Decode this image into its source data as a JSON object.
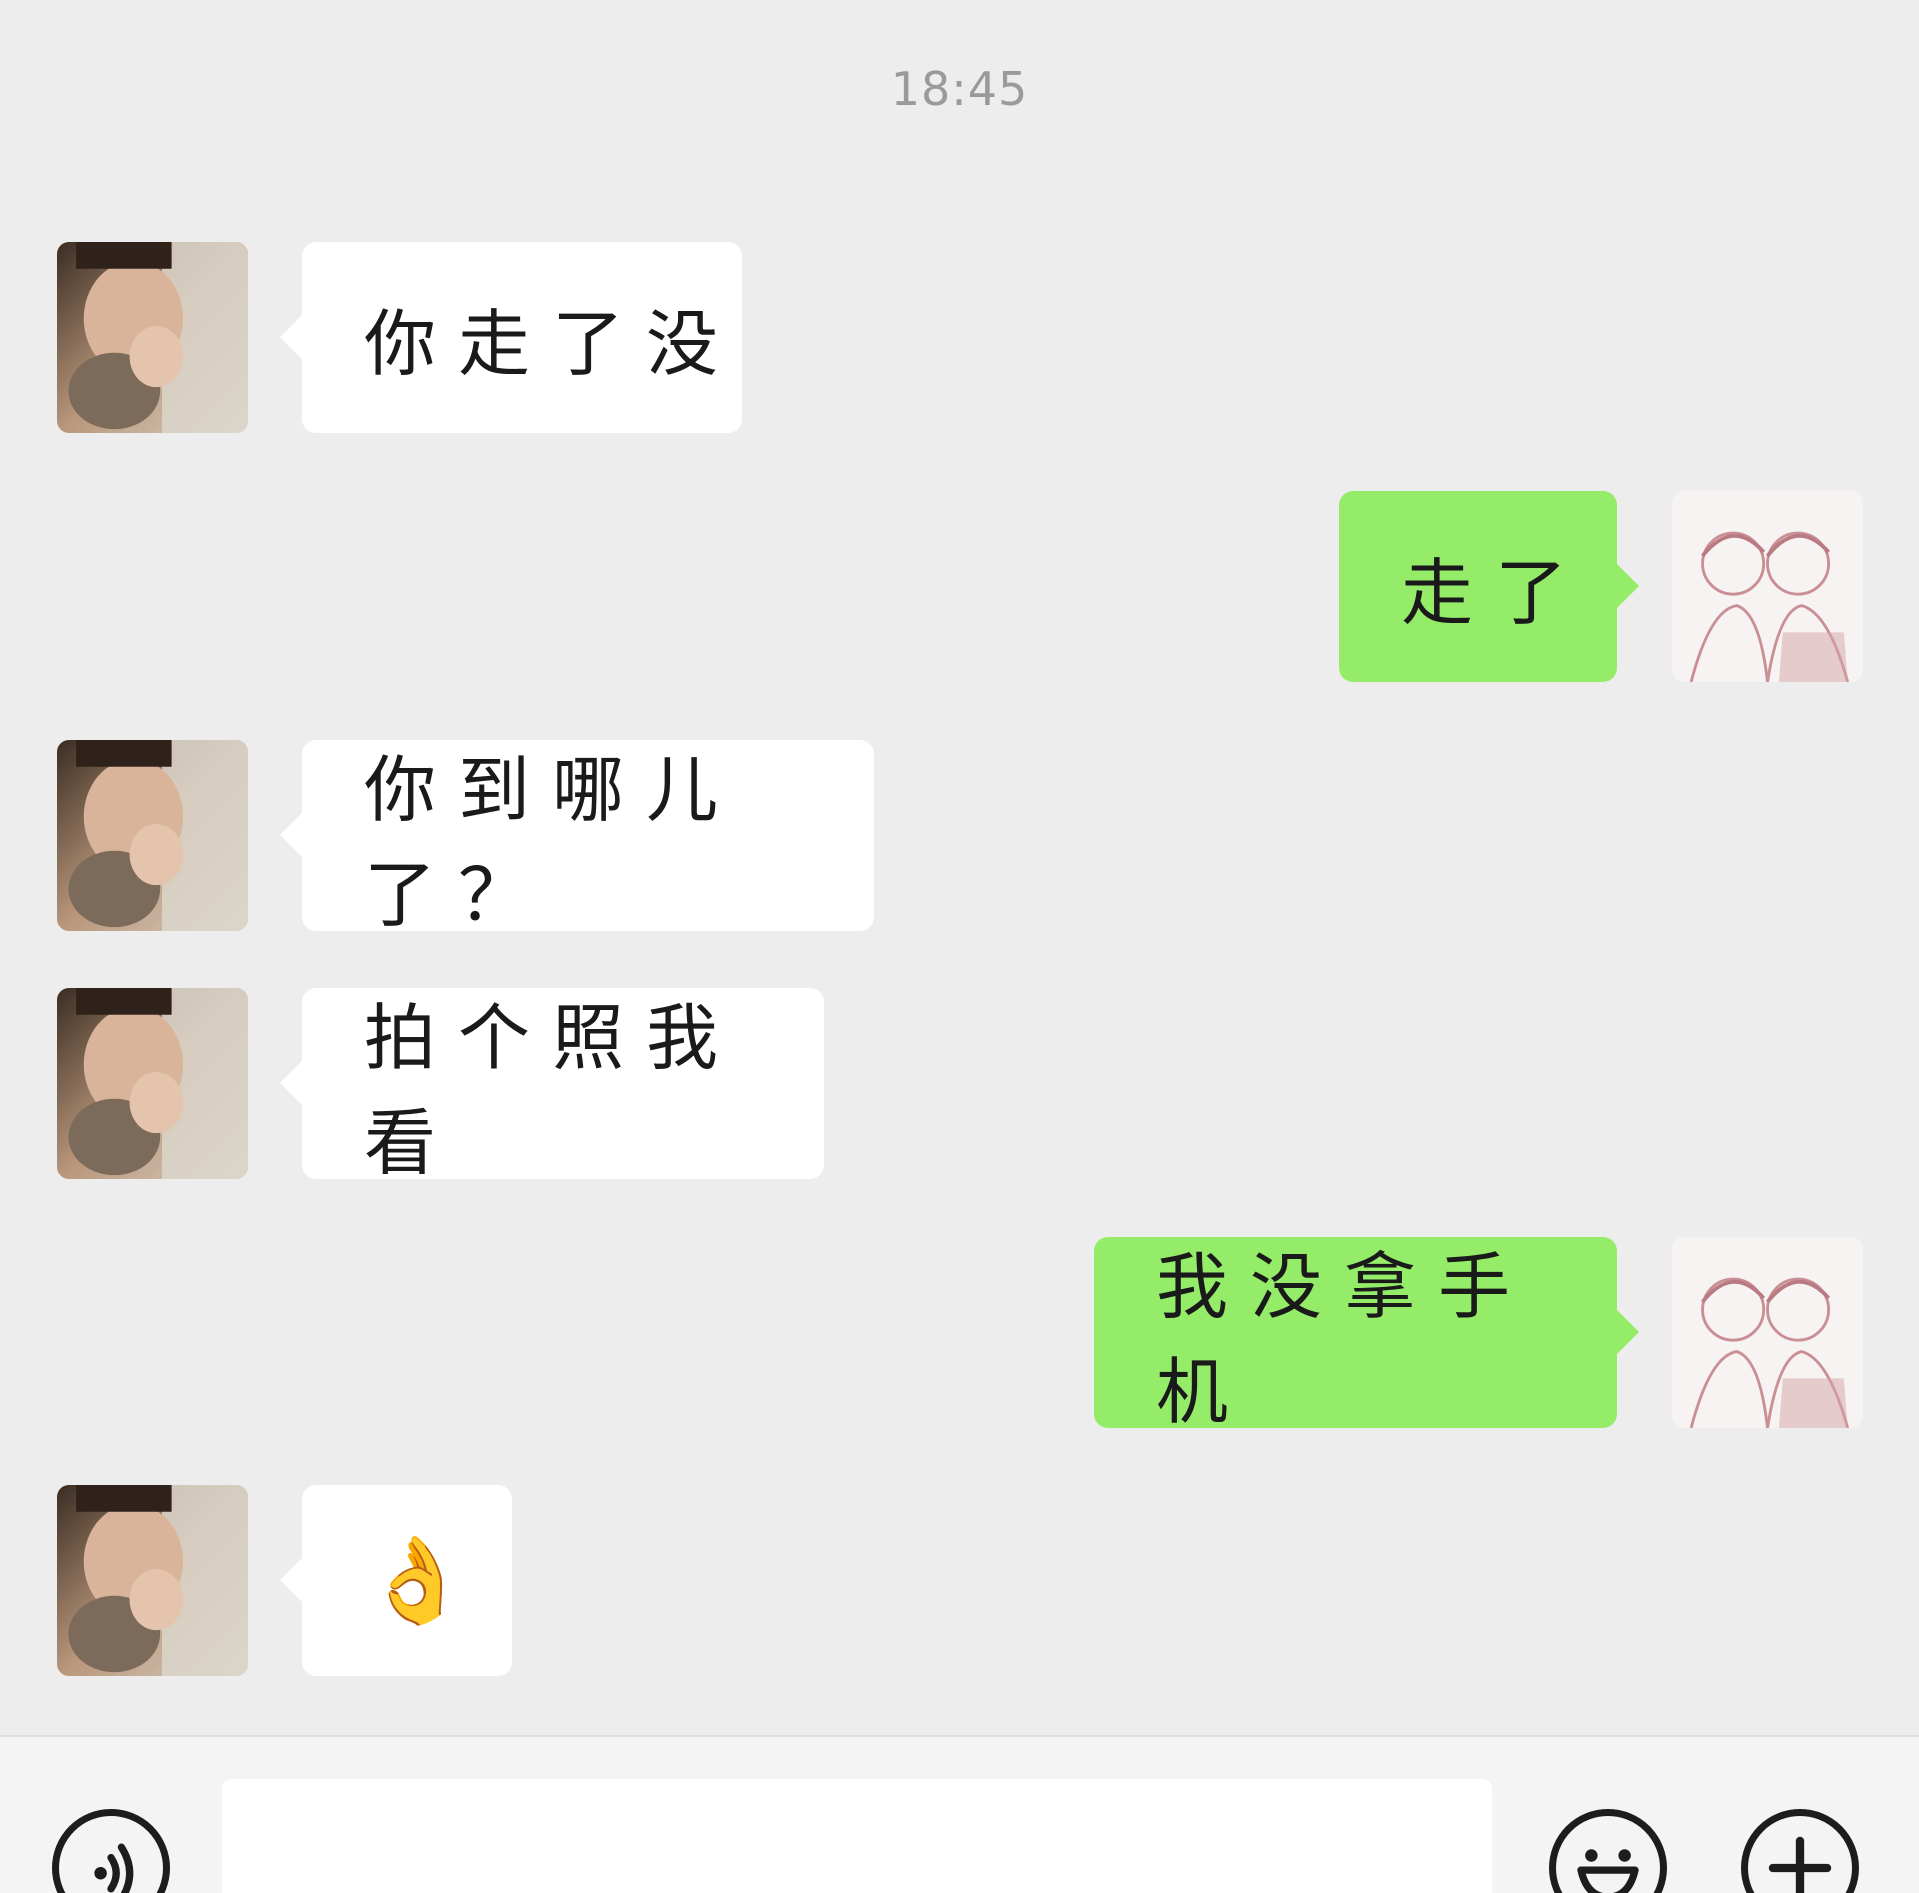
{
  "chat": {
    "timestamp": "18:45",
    "messages": [
      {
        "side": "left",
        "text": "你走了没"
      },
      {
        "side": "right",
        "text": "走了"
      },
      {
        "side": "left",
        "text": "你到哪儿了？"
      },
      {
        "side": "left",
        "text": "拍个照我看"
      },
      {
        "side": "right",
        "text": "我没拿手机"
      },
      {
        "side": "left",
        "text": "👌"
      }
    ]
  },
  "bottom_bar": {
    "voice_icon": "voice-icon",
    "emoji_icon": "emoji-icon",
    "plus_icon": "plus-icon"
  },
  "colors": {
    "background": "#ededed",
    "incoming_bubble": "#ffffff",
    "outgoing_bubble": "#95ec69"
  }
}
